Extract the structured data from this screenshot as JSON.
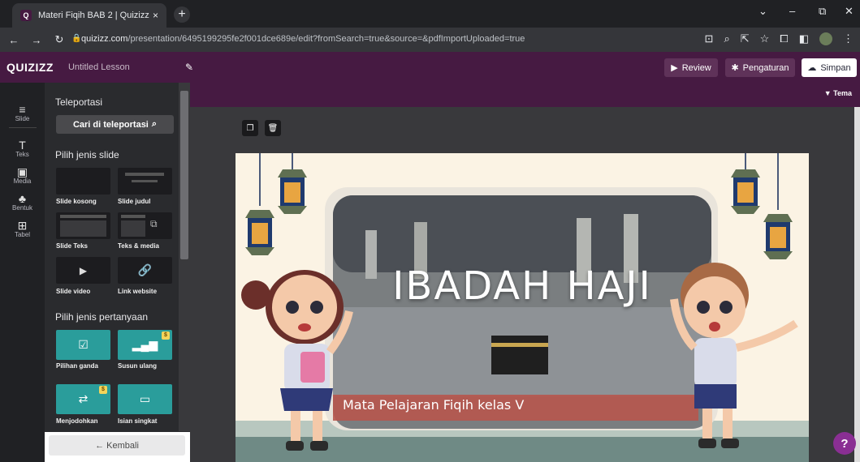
{
  "browser": {
    "tab_title": "Materi Fiqih BAB 2 | Quizizz",
    "tab_close": "×",
    "new_tab": "+",
    "url_host": "quizizz.com",
    "url_path": "/presentation/6495199295fe2f001dce689e/edit?fromSearch=true&source=&pdfImportUploaded=true",
    "win_min": "–",
    "win_max": "⧉",
    "win_close": "✕",
    "win_down": "⌄"
  },
  "header": {
    "logo": "QUIZIZZ",
    "lesson_title": "Untitled Lesson",
    "review_label": "Review",
    "settings_label": "Pengaturan",
    "save_label": "Simpan",
    "theme_label": "Tema"
  },
  "rail": [
    {
      "icon": "≡",
      "label": "Slide"
    },
    {
      "icon": "T",
      "label": "Teks"
    },
    {
      "icon": "▣",
      "label": "Media"
    },
    {
      "icon": "♣",
      "label": "Bentuk"
    },
    {
      "icon": "⊞",
      "label": "Tabel"
    }
  ],
  "panel": {
    "teleport_title": "Teleportasi",
    "search_label": "Cari di teleportasi",
    "slide_types_title": "Pilih jenis slide",
    "slide_types": [
      "Slide kosong",
      "Slide judul",
      "Slide Teks",
      "Teks & media",
      "Slide video",
      "Link website"
    ],
    "question_types_title": "Pilih jenis pertanyaan",
    "question_types": [
      "Pilihan ganda",
      "Susun ulang",
      "Menjodohkan",
      "Isian singkat"
    ],
    "back_label": "← Kembali"
  },
  "slide": {
    "title": "IBADAH HAJI",
    "subtitle": "Mata Pelajaran Fiqih kelas V"
  },
  "help_label": "?"
}
